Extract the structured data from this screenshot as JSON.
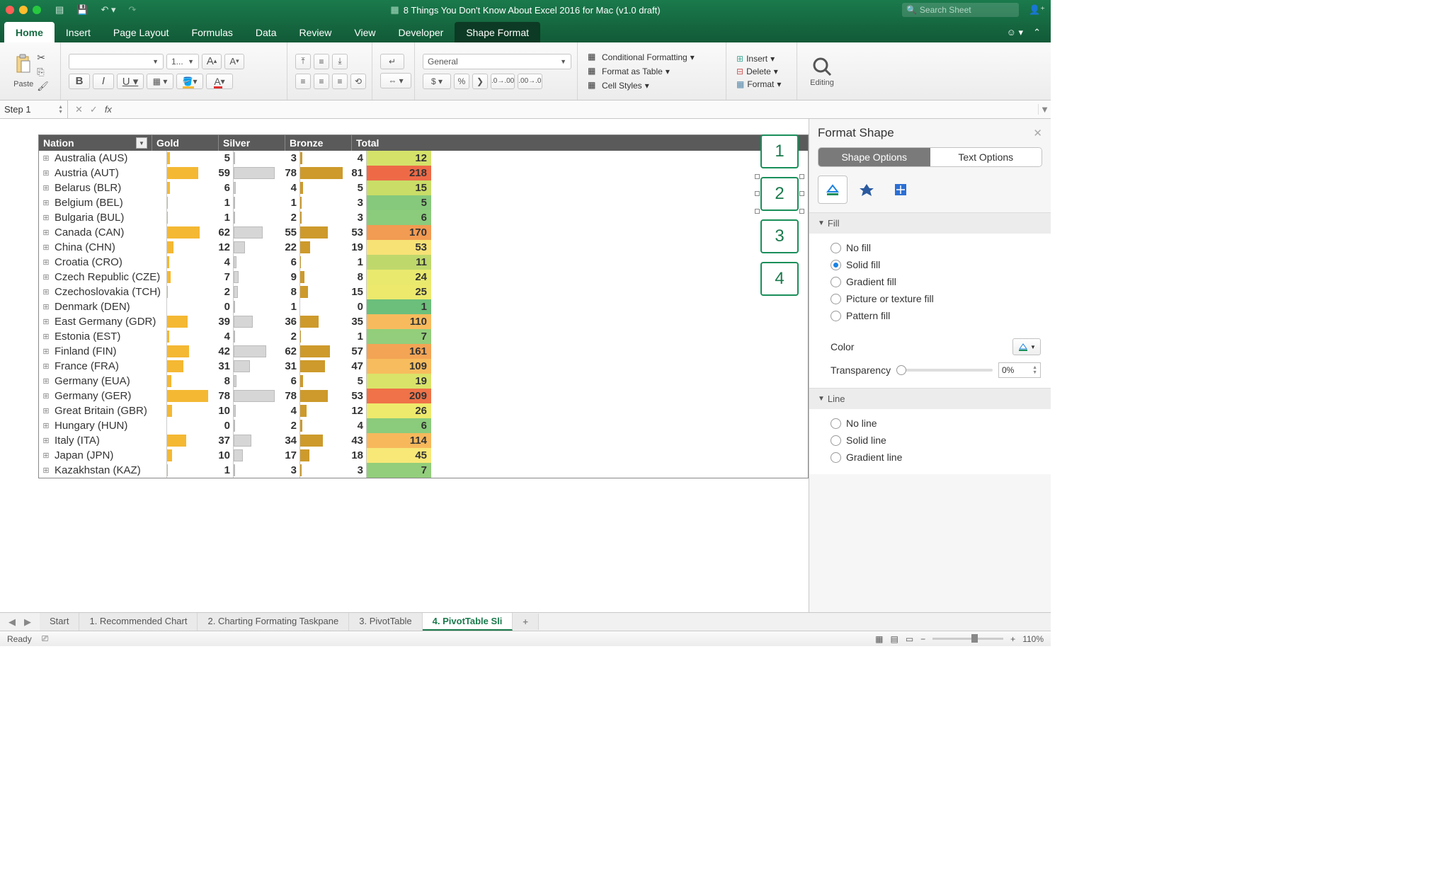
{
  "title": "8 Things You Don't Know About Excel 2016 for Mac (v1.0 draft)",
  "search_placeholder": "Search Sheet",
  "tabs": [
    "Home",
    "Insert",
    "Page Layout",
    "Formulas",
    "Data",
    "Review",
    "View",
    "Developer",
    "Shape Format"
  ],
  "active_tab": "Home",
  "context_tab": "Shape Format",
  "ribbon": {
    "paste": "Paste",
    "font_name": "",
    "font_size": "1...",
    "number_format": "General",
    "conditional_formatting": "Conditional Formatting",
    "format_as_table": "Format as Table",
    "cell_styles": "Cell Styles",
    "insert": "Insert",
    "delete": "Delete",
    "format": "Format",
    "editing": "Editing"
  },
  "name_box": "Step 1",
  "formula": "",
  "table": {
    "headers": [
      "Nation",
      "Gold",
      "Silver",
      "Bronze",
      "Total"
    ],
    "rows": [
      {
        "nation": "Australia (AUS)",
        "gold": 5,
        "silver": 3,
        "bronze": 4,
        "total": 12,
        "tcolor": "#d4e26a"
      },
      {
        "nation": "Austria (AUT)",
        "gold": 59,
        "silver": 78,
        "bronze": 81,
        "total": 218,
        "tcolor": "#ee6a47"
      },
      {
        "nation": "Belarus (BLR)",
        "gold": 6,
        "silver": 4,
        "bronze": 5,
        "total": 15,
        "tcolor": "#c9dd67"
      },
      {
        "nation": "Belgium (BEL)",
        "gold": 1,
        "silver": 1,
        "bronze": 3,
        "total": 5,
        "tcolor": "#86c97c"
      },
      {
        "nation": "Bulgaria (BUL)",
        "gold": 1,
        "silver": 2,
        "bronze": 3,
        "total": 6,
        "tcolor": "#8bcb7c"
      },
      {
        "nation": "Canada (CAN)",
        "gold": 62,
        "silver": 55,
        "bronze": 53,
        "total": 170,
        "tcolor": "#f29b52"
      },
      {
        "nation": "China (CHN)",
        "gold": 12,
        "silver": 22,
        "bronze": 19,
        "total": 53,
        "tcolor": "#f7e276"
      },
      {
        "nation": "Croatia (CRO)",
        "gold": 4,
        "silver": 6,
        "bronze": 1,
        "total": 11,
        "tcolor": "#bfd86c"
      },
      {
        "nation": "Czech Republic (CZE)",
        "gold": 7,
        "silver": 9,
        "bronze": 8,
        "total": 24,
        "tcolor": "#e9e96e"
      },
      {
        "nation": "Czechoslovakia (TCH)",
        "gold": 2,
        "silver": 8,
        "bronze": 15,
        "total": 25,
        "tcolor": "#ece96d"
      },
      {
        "nation": "Denmark (DEN)",
        "gold": 0,
        "silver": 1,
        "bronze": 0,
        "total": 1,
        "tcolor": "#6bbf7b"
      },
      {
        "nation": "East Germany (GDR)",
        "gold": 39,
        "silver": 36,
        "bronze": 35,
        "total": 110,
        "tcolor": "#f7bb5d"
      },
      {
        "nation": "Estonia (EST)",
        "gold": 4,
        "silver": 2,
        "bronze": 1,
        "total": 7,
        "tcolor": "#92ce7b"
      },
      {
        "nation": "Finland (FIN)",
        "gold": 42,
        "silver": 62,
        "bronze": 57,
        "total": 161,
        "tcolor": "#f3a454"
      },
      {
        "nation": "France (FRA)",
        "gold": 31,
        "silver": 31,
        "bronze": 47,
        "total": 109,
        "tcolor": "#f7bc5d"
      },
      {
        "nation": "Germany (EUA)",
        "gold": 8,
        "silver": 6,
        "bronze": 5,
        "total": 19,
        "tcolor": "#d9e369"
      },
      {
        "nation": "Germany (GER)",
        "gold": 78,
        "silver": 78,
        "bronze": 53,
        "total": 209,
        "tcolor": "#ef7248"
      },
      {
        "nation": "Great Britain (GBR)",
        "gold": 10,
        "silver": 4,
        "bronze": 12,
        "total": 26,
        "tcolor": "#eeea6c"
      },
      {
        "nation": "Hungary (HUN)",
        "gold": 0,
        "silver": 2,
        "bronze": 4,
        "total": 6,
        "tcolor": "#8bcb7c"
      },
      {
        "nation": "Italy (ITA)",
        "gold": 37,
        "silver": 34,
        "bronze": 43,
        "total": 114,
        "tcolor": "#f7b85c"
      },
      {
        "nation": "Japan (JPN)",
        "gold": 10,
        "silver": 17,
        "bronze": 18,
        "total": 45,
        "tcolor": "#f7e878"
      },
      {
        "nation": "Kazakhstan (KAZ)",
        "gold": 1,
        "silver": 3,
        "bronze": 3,
        "total": 7,
        "tcolor": "#92ce7b"
      }
    ],
    "max_medal": 81
  },
  "slicer_values": [
    "1",
    "2",
    "3",
    "4"
  ],
  "sidepane": {
    "title": "Format Shape",
    "tab1": "Shape Options",
    "tab2": "Text Options",
    "fill_section": "Fill",
    "fill_options": [
      "No fill",
      "Solid fill",
      "Gradient fill",
      "Picture or texture fill",
      "Pattern fill"
    ],
    "fill_selected": 1,
    "color_label": "Color",
    "transparency_label": "Transparency",
    "transparency_value": "0%",
    "line_section": "Line",
    "line_options": [
      "No line",
      "Solid line",
      "Gradient line"
    ]
  },
  "sheet_tabs": [
    "Start",
    "1. Recommended Chart",
    "2. Charting Formating Taskpane",
    "3. PivotTable",
    "4. PivotTable Sli"
  ],
  "active_sheet": 4,
  "status": "Ready",
  "zoom": "110%"
}
